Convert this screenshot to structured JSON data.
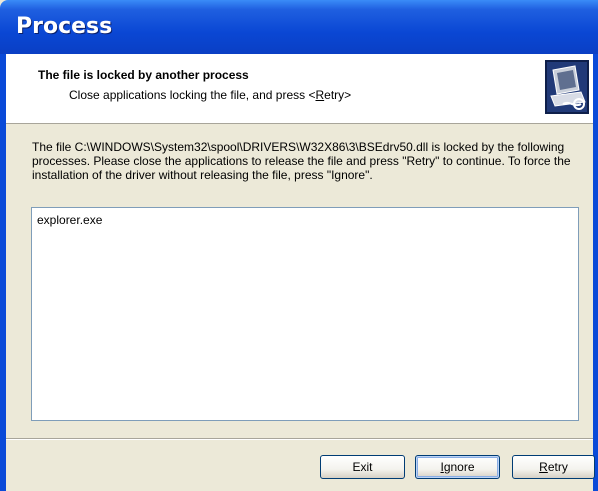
{
  "window": {
    "title": "Process"
  },
  "header": {
    "title": "The file is locked by another process",
    "subtitle_prefix": "Close applications locking the file, and press <",
    "subtitle_accel": "R",
    "subtitle_rest": "etry>",
    "icon": "computer-setup-icon"
  },
  "main": {
    "description": "The file C:\\WINDOWS\\System32\\spool\\DRIVERS\\W32X86\\3\\BSEdrv50.dll is locked by the following processes. Please close the applications to release the file and press \"Retry\" to continue. To force the installation of the driver without releasing the file, press \"Ignore\".",
    "processes": [
      "explorer.exe"
    ]
  },
  "buttons": {
    "exit_label": "Exit",
    "ignore_accel": "I",
    "ignore_rest": "gnore",
    "retry_accel": "R",
    "retry_rest": "etry"
  },
  "colors": {
    "titlebar": "#0a47d4",
    "dialog_bg": "#ece9d8",
    "button_border": "#003c74"
  }
}
